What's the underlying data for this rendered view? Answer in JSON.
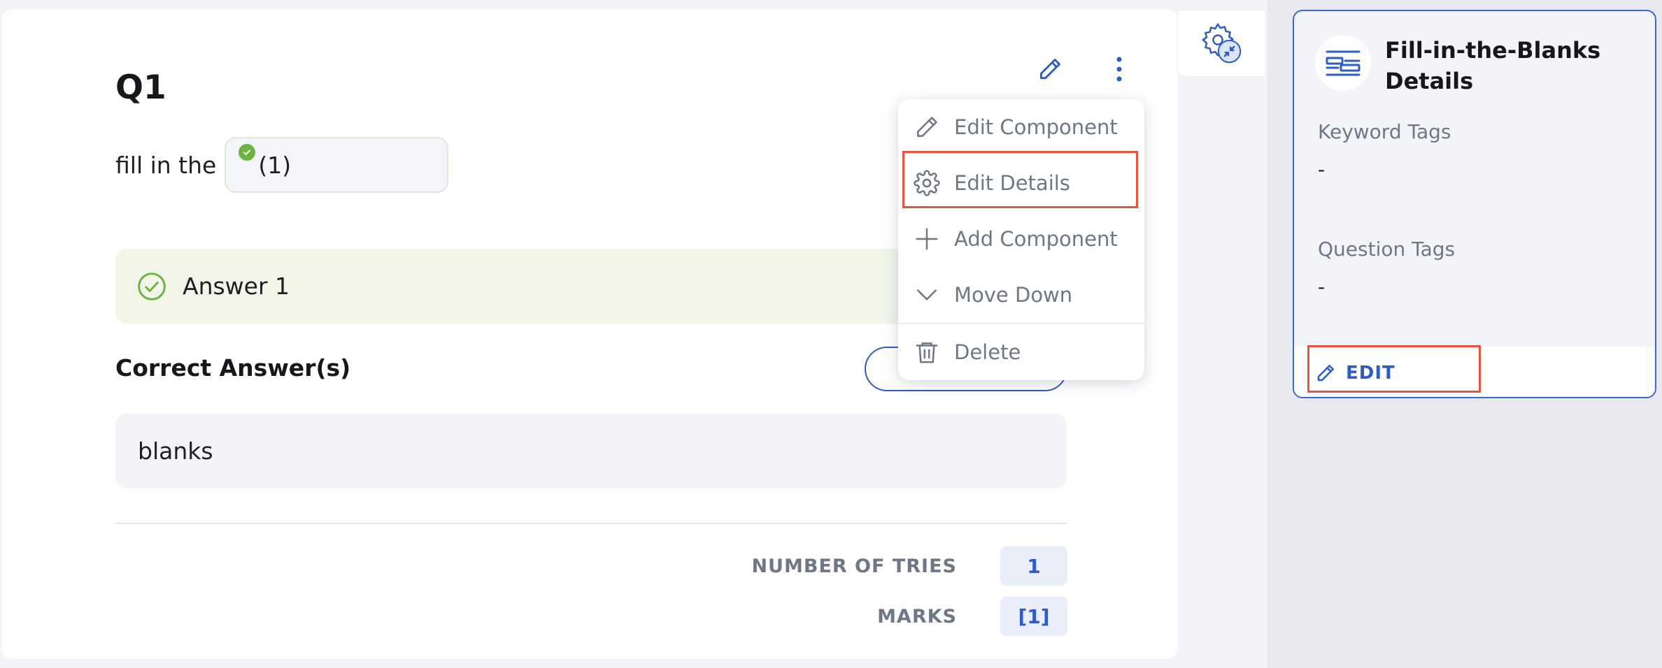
{
  "question": {
    "title": "Q1",
    "prompt_text": "fill in the",
    "blank_label": "(1)",
    "answer_option": "Answer 1",
    "correct_answers_label": "Correct Answer(s)",
    "correct_answer_value": "blanks",
    "number_of_tries_label": "NUMBER OF TRIES",
    "number_of_tries_value": "1",
    "marks_label": "MARKS",
    "marks_value": "[1]"
  },
  "menu": {
    "items": [
      {
        "label": "Edit Component",
        "icon": "pencil-icon"
      },
      {
        "label": "Edit Details",
        "icon": "gear-icon"
      },
      {
        "label": "Add Component",
        "icon": "plus-icon"
      },
      {
        "label": "Move Down",
        "icon": "chevron-down-icon"
      },
      {
        "label": "Delete",
        "icon": "trash-icon"
      }
    ]
  },
  "details": {
    "title": "Fill-in-the-Blanks Details",
    "keyword_tags_label": "Keyword Tags",
    "keyword_tags_value": "-",
    "question_tags_label": "Question Tags",
    "question_tags_value": "-",
    "edit_label": "EDIT"
  },
  "colors": {
    "accent": "#2d5cc7",
    "success": "#6db33f",
    "highlight": "#e8553a"
  }
}
